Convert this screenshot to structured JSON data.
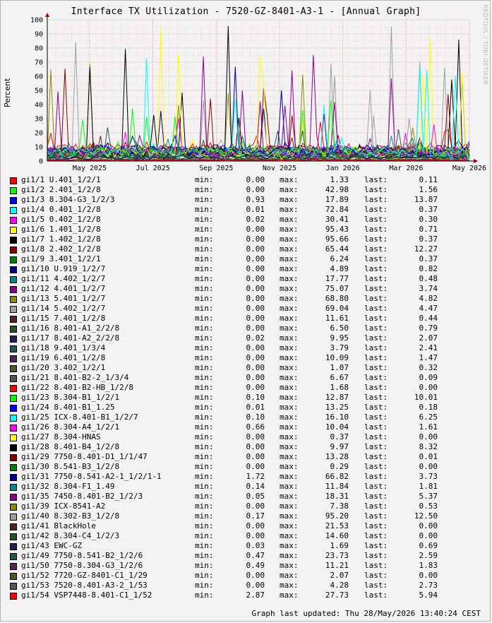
{
  "title": "Interface TX Utilization - 7520-GZ-8401-A3-1 - [Annual Graph]",
  "watermark": "RRDTOOL / TOBI OETIKER",
  "footer": "Graph last updated: Thu 28/May/2026 13:40:24 CEST",
  "legend_labels": {
    "min": "min:",
    "max": "max:",
    "last": "last:"
  },
  "chart_data": {
    "type": "line",
    "title": "Interface TX Utilization - 7520-GZ-8401-A3-1 - [Annual Graph]",
    "ylabel": "Percent",
    "xlabel": "",
    "ylim": [
      0,
      100
    ],
    "yticks": [
      0,
      10,
      20,
      30,
      40,
      50,
      60,
      70,
      80,
      90,
      100
    ],
    "xticks": [
      "May 2025",
      "Jul 2025",
      "Sep 2025",
      "Nov 2025",
      "Jan 2026",
      "Mar 2026",
      "May 2026"
    ],
    "grid": true,
    "legend_position": "bottom",
    "series": [
      {
        "name": "gi1/1 U.401_1/2/1",
        "color": "#ff0000",
        "min": "0.00",
        "max": "1.33",
        "last": "0.11"
      },
      {
        "name": "gi1/2 2.401_1/2/8",
        "color": "#00ff00",
        "min": "0.00",
        "max": "42.98",
        "last": "1.56"
      },
      {
        "name": "gi1/3 8.304-G3_1/2/3",
        "color": "#0000ff",
        "min": "0.93",
        "max": "17.89",
        "last": "13.87"
      },
      {
        "name": "gi1/4 0.401_1/2/8",
        "color": "#00ffff",
        "min": "0.01",
        "max": "72.84",
        "last": "0.37"
      },
      {
        "name": "gi1/5 0.402_1/2/8",
        "color": "#ff00ff",
        "min": "0.02",
        "max": "30.41",
        "last": "0.30"
      },
      {
        "name": "gi1/6 1.401_1/2/8",
        "color": "#ffff00",
        "min": "0.00",
        "max": "95.43",
        "last": "0.71"
      },
      {
        "name": "gi1/7 1.402_1/2/8",
        "color": "#000000",
        "min": "0.00",
        "max": "95.66",
        "last": "0.37"
      },
      {
        "name": "gi1/8 2.402_1/2/8",
        "color": "#8b0000",
        "min": "0.00",
        "max": "65.44",
        "last": "12.27"
      },
      {
        "name": "gi1/9 3.401_1/2/1",
        "color": "#008000",
        "min": "0.00",
        "max": "6.24",
        "last": "0.37"
      },
      {
        "name": "gi1/10 U.919_1/2/7",
        "color": "#00008b",
        "min": "0.00",
        "max": "4.89",
        "last": "0.82"
      },
      {
        "name": "gi1/11 4.402_1/2/7",
        "color": "#008b8b",
        "min": "0.00",
        "max": "17.77",
        "last": "0.48"
      },
      {
        "name": "gi1/12 4.401_1/2/7",
        "color": "#8b008b",
        "min": "0.00",
        "max": "75.07",
        "last": "3.74"
      },
      {
        "name": "gi1/13 5.401_1/2/7",
        "color": "#8b8b00",
        "min": "0.00",
        "max": "68.80",
        "last": "4.82"
      },
      {
        "name": "gi1/14 5.402_1/2/7",
        "color": "#a0a0a0",
        "min": "0.00",
        "max": "69.04",
        "last": "4.47"
      },
      {
        "name": "gi1/15 7.401_1/2/8",
        "color": "#552222",
        "min": "0.00",
        "max": "11.61",
        "last": "0.44"
      },
      {
        "name": "gi1/16 8.401-A1_2/2/8",
        "color": "#225522",
        "min": "0.00",
        "max": "6.50",
        "last": "0.79"
      },
      {
        "name": "gi1/17 8.401-A2_2/2/8",
        "color": "#222255",
        "min": "0.02",
        "max": "9.95",
        "last": "2.07"
      },
      {
        "name": "gi1/18 9.401_1/3/4",
        "color": "#225555",
        "min": "0.00",
        "max": "3.79",
        "last": "2.41"
      },
      {
        "name": "gi1/19 6.401_1/2/8",
        "color": "#552255",
        "min": "0.00",
        "max": "10.09",
        "last": "1.47"
      },
      {
        "name": "gi1/20 3.402_1/2/1",
        "color": "#555522",
        "min": "0.00",
        "max": "1.07",
        "last": "0.32"
      },
      {
        "name": "gi1/21 8.401-B2-2_1/3/4",
        "color": "#555555",
        "min": "0.00",
        "max": "6.67",
        "last": "0.09"
      },
      {
        "name": "gi1/22 8.401-B2-HB_1/2/8",
        "color": "#ff0000",
        "min": "0.00",
        "max": "1.68",
        "last": "0.00"
      },
      {
        "name": "gi1/23 8.304-B1_1/2/1",
        "color": "#00ff00",
        "min": "0.10",
        "max": "12.87",
        "last": "10.01"
      },
      {
        "name": "gi1/24 8.401-B1_1.25",
        "color": "#0000ff",
        "min": "0.01",
        "max": "13.25",
        "last": "0.18"
      },
      {
        "name": "gi1/25 ICX-8.401-B1_1/2/7",
        "color": "#00ffff",
        "min": "0.10",
        "max": "16.10",
        "last": "6.25"
      },
      {
        "name": "gi1/26 8.304-A4_1/2/1",
        "color": "#ff00ff",
        "min": "0.66",
        "max": "10.04",
        "last": "1.61"
      },
      {
        "name": "gi1/27 8.304-HNAS",
        "color": "#ffff00",
        "min": "0.00",
        "max": "0.37",
        "last": "0.00"
      },
      {
        "name": "gi1/28 8.401-B4_1/2/8",
        "color": "#000000",
        "min": "0.00",
        "max": "9.97",
        "last": "8.32"
      },
      {
        "name": "gi1/29 7750-8.401-D1_1/1/47",
        "color": "#8b0000",
        "min": "0.00",
        "max": "13.28",
        "last": "0.01"
      },
      {
        "name": "gi1/30 8.541-B3_1/2/8",
        "color": "#008000",
        "min": "0.00",
        "max": "0.29",
        "last": "0.00"
      },
      {
        "name": "gi1/31 7750-8.541-A2-1_1/2/1-1",
        "color": "#00008b",
        "min": "1.72",
        "max": "66.82",
        "last": "3.73"
      },
      {
        "name": "gi1/32 8.304-F1_1.49",
        "color": "#008b8b",
        "min": "0.14",
        "max": "11.84",
        "last": "1.81"
      },
      {
        "name": "gi1/35 7450-8.401-B2_1/2/3",
        "color": "#8b008b",
        "min": "0.05",
        "max": "18.31",
        "last": "5.37"
      },
      {
        "name": "gi1/39 ICX-8541-A2",
        "color": "#8b8b00",
        "min": "0.00",
        "max": "7.38",
        "last": "0.53"
      },
      {
        "name": "gi1/40 8.302-B3_1/2/8",
        "color": "#a0a0a0",
        "min": "0.17",
        "max": "95.20",
        "last": "12.50"
      },
      {
        "name": "gi1/41 BlackHole",
        "color": "#552222",
        "min": "0.00",
        "max": "21.53",
        "last": "0.00"
      },
      {
        "name": "gi1/42 8.304-C4_1/2/3",
        "color": "#225522",
        "min": "0.00",
        "max": "14.60",
        "last": "0.00"
      },
      {
        "name": "gi1/43 EWC-GZ",
        "color": "#222255",
        "min": "0.03",
        "max": "1.69",
        "last": "0.69"
      },
      {
        "name": "gi1/49 7750-8.541-B2_1/2/6",
        "color": "#225555",
        "min": "0.47",
        "max": "23.73",
        "last": "2.59"
      },
      {
        "name": "gi1/50 7750-8.304-G3_1/2/6",
        "color": "#552255",
        "min": "0.49",
        "max": "11.21",
        "last": "1.83"
      },
      {
        "name": "gi1/52 7720-GZ-8401-C1_1/29",
        "color": "#555522",
        "min": "0.00",
        "max": "2.07",
        "last": "0.00"
      },
      {
        "name": "gi1/53 7520-8.401-A3-2_1/53",
        "color": "#555555",
        "min": "0.00",
        "max": "4.28",
        "last": "2.73"
      },
      {
        "name": "gi1/54 VSP7448-8.401-C1_1/52",
        "color": "#ff0000",
        "min": "2.87",
        "max": "27.73",
        "last": "5.94"
      }
    ]
  }
}
